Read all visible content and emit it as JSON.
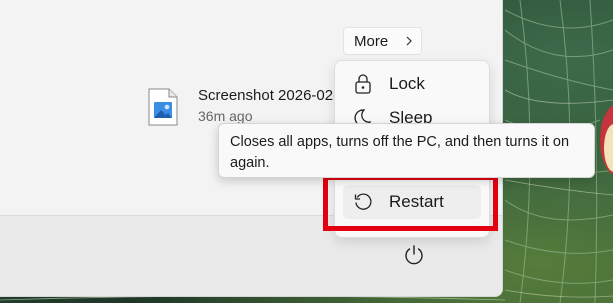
{
  "start_menu": {
    "more_button": {
      "label": "More",
      "icon": "chevron-right-icon"
    },
    "recent_file": {
      "icon": "image-file-icon",
      "name": "Screenshot 2026-02-",
      "time": "36m ago"
    },
    "power_button": {
      "icon": "power-icon"
    }
  },
  "power_menu": {
    "items": [
      {
        "label": "Lock",
        "icon": "lock-icon"
      },
      {
        "label": "Sleep",
        "icon": "sleep-icon"
      },
      {
        "label": "Restart",
        "icon": "restart-icon"
      }
    ]
  },
  "tooltip": {
    "text": "Closes all apps, turns off the PC, and then turns it on again."
  },
  "colors": {
    "highlight": "#e3000f",
    "panel_bg": "#f3f3f3"
  }
}
